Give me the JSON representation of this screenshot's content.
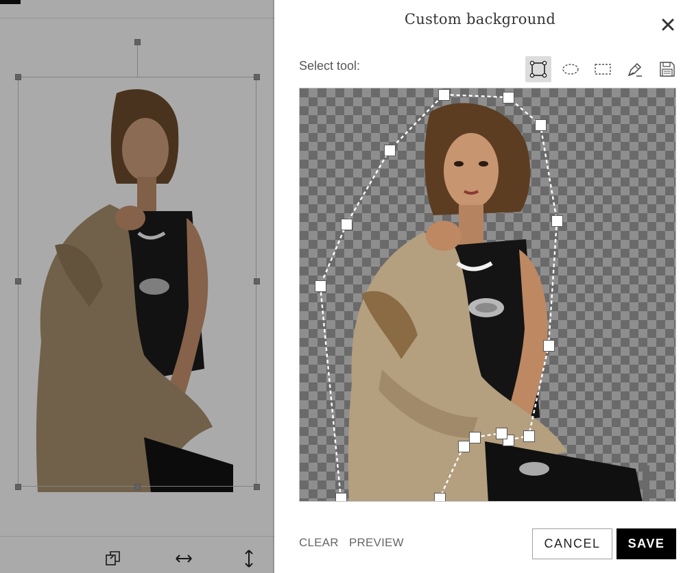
{
  "dialog": {
    "title": "Custom background",
    "select_tool_label": "Select tool:",
    "tools": [
      {
        "icon": "polygon-select-icon",
        "active": true
      },
      {
        "icon": "ellipse-select-icon",
        "active": false
      },
      {
        "icon": "rectangle-select-icon",
        "active": false
      },
      {
        "icon": "pen-draw-icon",
        "active": false
      },
      {
        "icon": "save-disk-icon",
        "active": false
      }
    ],
    "footer": {
      "clear_label": "CLEAR",
      "preview_label": "PREVIEW",
      "cancel_label": "CANCEL",
      "save_label": "SAVE"
    }
  },
  "editor": {
    "bottom_tools": [
      "duplicate-icon",
      "flip-horizontal-icon",
      "flip-vertical-icon"
    ]
  },
  "colors": {
    "primary_button": "#000000",
    "checker_light": "#8e8e8e",
    "checker_dark": "#6a6a6a"
  }
}
